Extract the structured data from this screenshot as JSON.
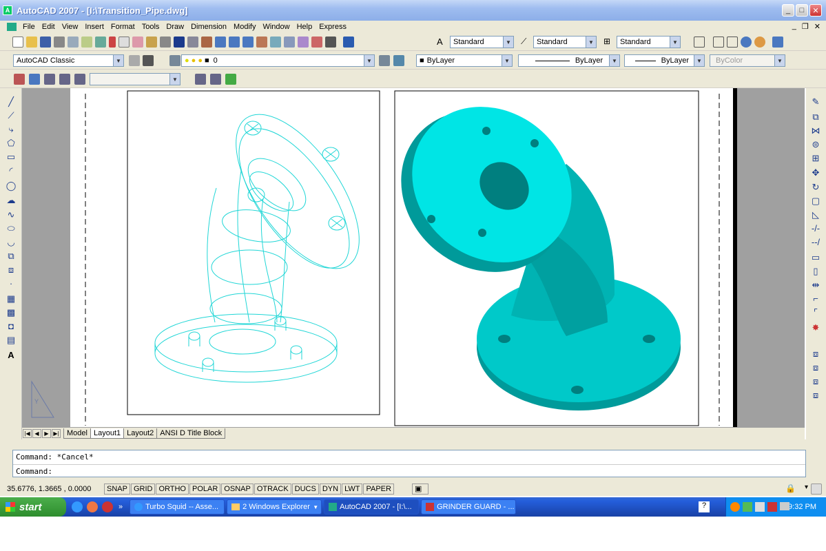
{
  "window": {
    "title": "AutoCAD 2007 - [I:\\Transition_Pipe.dwg]",
    "icon": "autocad-icon"
  },
  "menu": [
    "File",
    "Edit",
    "View",
    "Insert",
    "Format",
    "Tools",
    "Draw",
    "Dimension",
    "Modify",
    "Window",
    "Help",
    "Express"
  ],
  "styles": {
    "text_style": "Standard",
    "dim_style": "Standard",
    "table_style": "Standard"
  },
  "workspace": "AutoCAD Classic",
  "layer": "0",
  "properties": {
    "color": "ByLayer",
    "linetype": "ByLayer",
    "lineweight": "ByLayer",
    "plotstyle": "ByColor"
  },
  "layout_tabs": [
    "Model",
    "Layout1",
    "Layout2",
    "ANSI D Title Block"
  ],
  "active_tab": "Layout1",
  "command": {
    "history": "Command: *Cancel*",
    "prompt": "Command:"
  },
  "coords": "35.6776, 1.3665 , 0.0000",
  "status_buttons": [
    "SNAP",
    "GRID",
    "ORTHO",
    "POLAR",
    "OSNAP",
    "OTRACK",
    "DUCS",
    "DYN",
    "LWT",
    "PAPER"
  ],
  "taskbar": {
    "start": "start",
    "tasks": [
      "Turbo Squid -- Asse...",
      "2 Windows Explorer",
      "AutoCAD 2007 - [I:\\...",
      "GRINDER GUARD - ..."
    ],
    "clock": "9:32 PM"
  },
  "colors": {
    "model": "#00e5e5",
    "titlebar": "#8daee8",
    "taskbar": "#245edb"
  }
}
